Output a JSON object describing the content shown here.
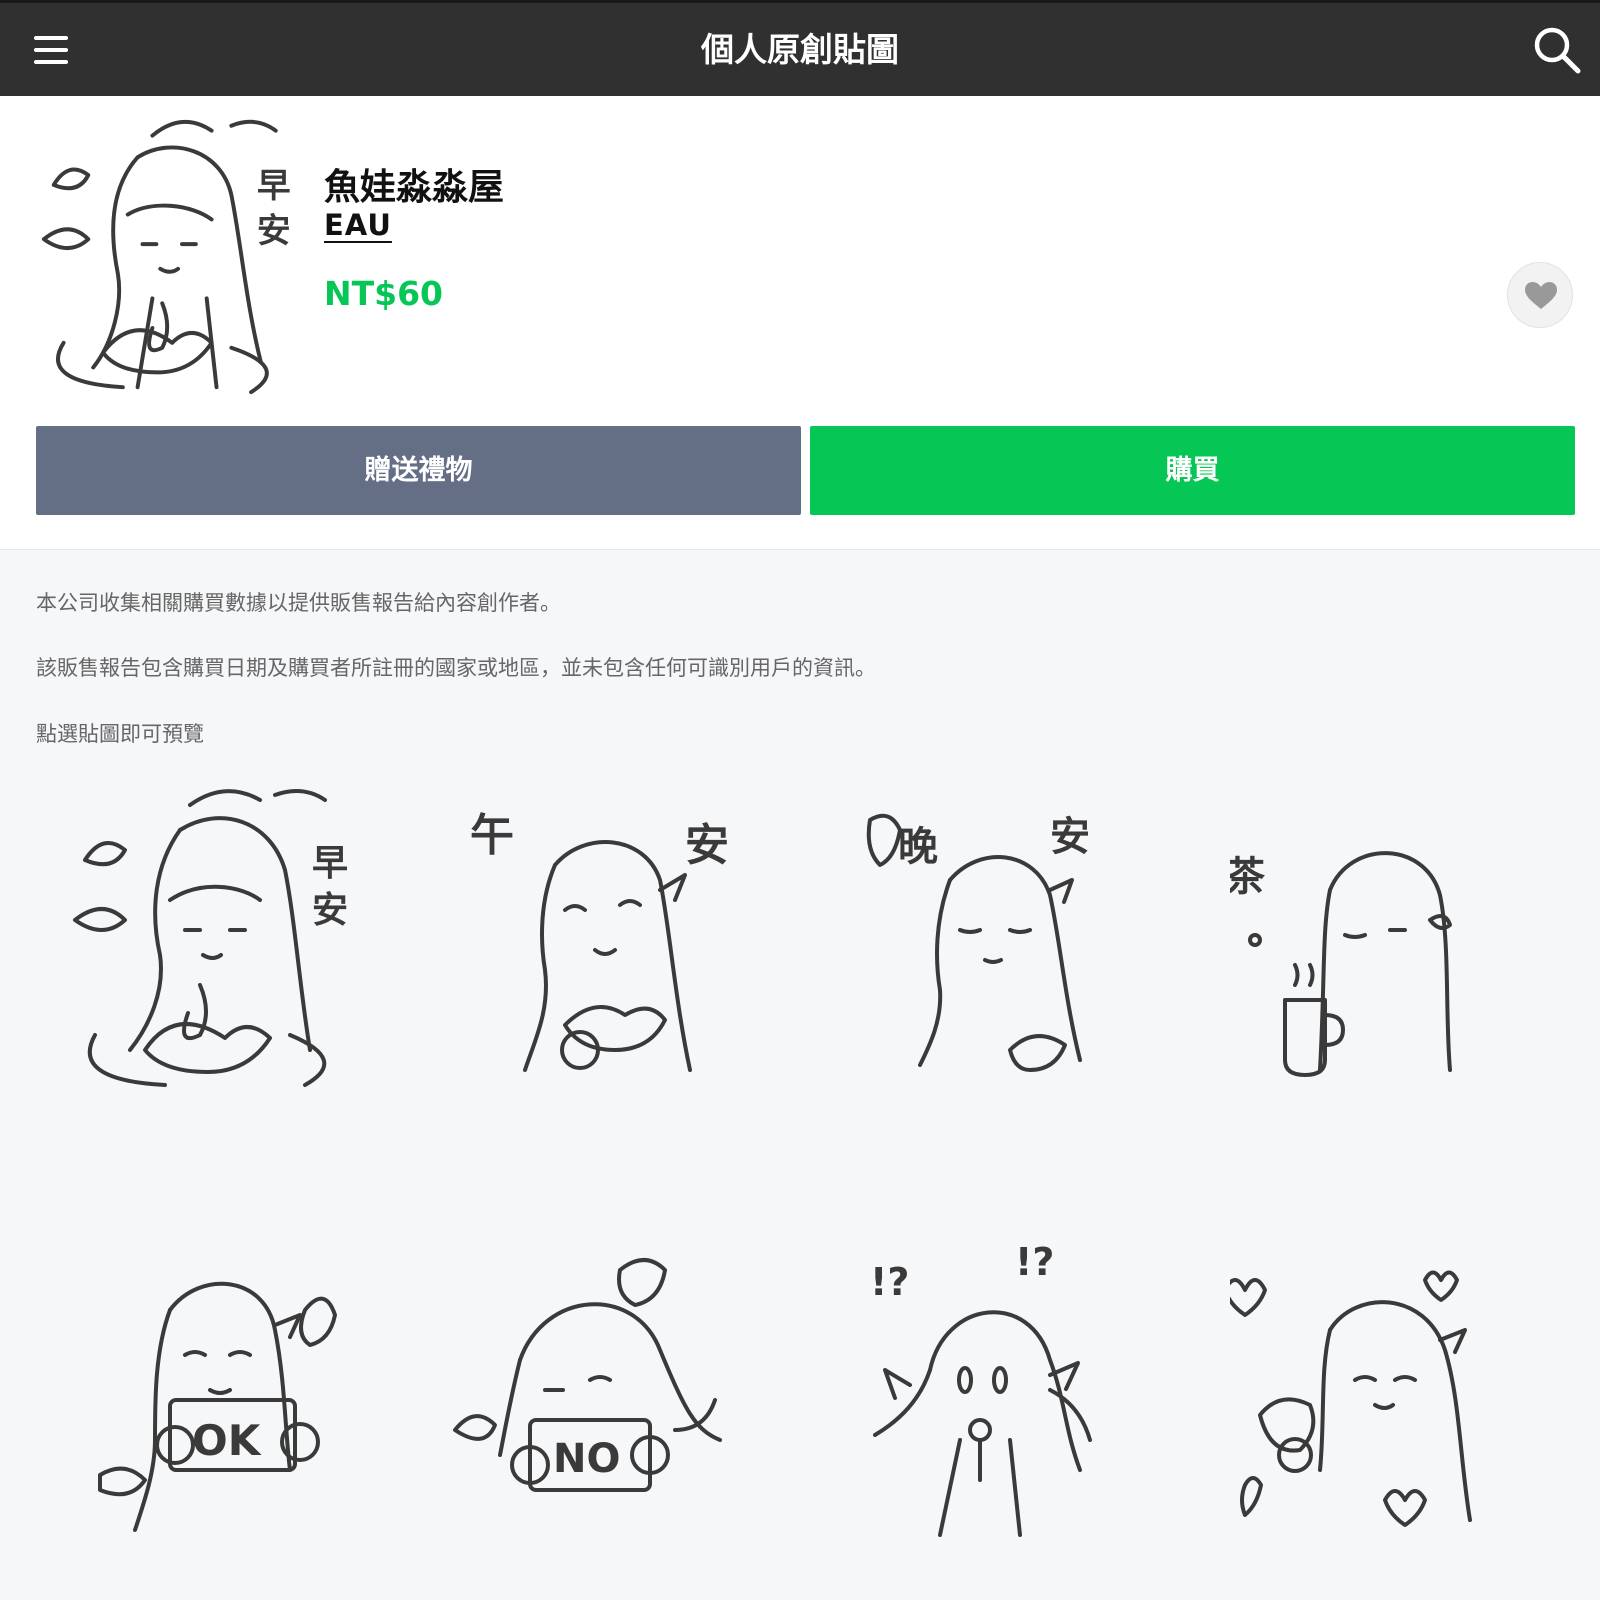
{
  "header": {
    "title": "個人原創貼圖"
  },
  "product": {
    "name": "魚娃淼淼屋",
    "author": "EAU",
    "price": "NT$60"
  },
  "actions": {
    "gift_label": "贈送禮物",
    "buy_label": "購買"
  },
  "notes": {
    "line1": "本公司收集相關購買數據以提供販售報告給內容創作者。",
    "line2": "該販售報告包含購買日期及購買者所註冊的國家或地區，並未包含任何可識別用戶的資訊。",
    "line3": "點選貼圖即可預覽"
  },
  "stickers": {
    "s1": {
      "text_a": "早",
      "text_b": "安"
    },
    "s2": {
      "text_a": "午",
      "text_b": "安"
    },
    "s3": {
      "text_a": "晚",
      "text_b": "安"
    },
    "s4": {
      "text_a": "茶"
    },
    "s5": {
      "text_a": "OK"
    },
    "s6": {
      "text_a": "NO"
    },
    "s7": {
      "text_a": "!?",
      "text_b": "!?"
    },
    "s8": {}
  },
  "colors": {
    "topbar": "#303030",
    "buy_green": "#06c755",
    "gift_gray": "#646f85",
    "price_green": "#06c755"
  },
  "icons": {
    "menu": "hamburger-menu-icon",
    "search": "search-icon",
    "favorite": "heart-icon"
  }
}
